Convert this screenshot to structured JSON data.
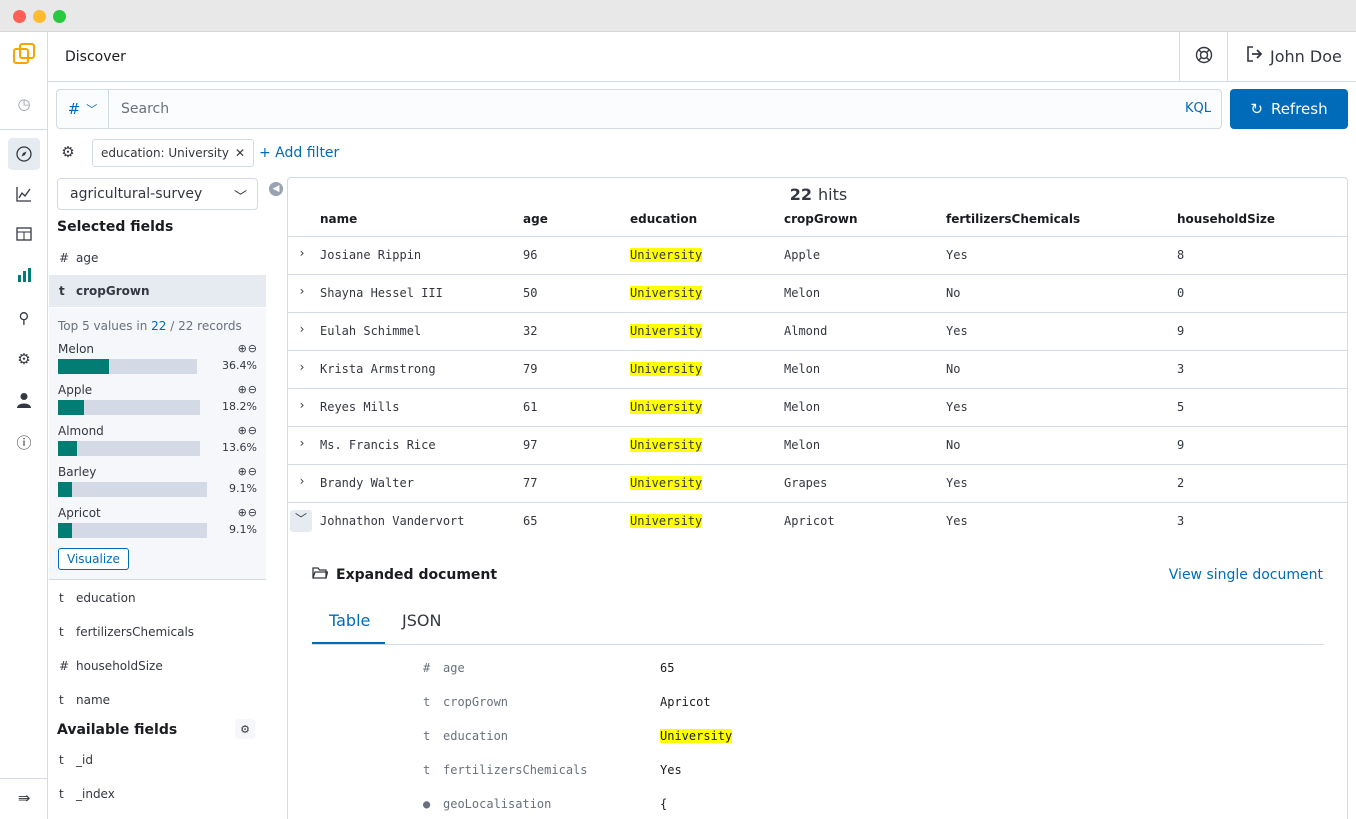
{
  "header": {
    "title": "Discover",
    "user_name": "John Doe"
  },
  "query": {
    "type_symbol": "#",
    "placeholder": "Search",
    "language": "KQL",
    "refresh_label": "Refresh"
  },
  "filters": {
    "pill_label": "education: University",
    "add_filter_label": "+ Add filter"
  },
  "sidebar": {
    "index_pattern": "agricultural-survey",
    "selected_heading": "Selected fields",
    "selected_fields": [
      {
        "type": "#",
        "name": "age"
      },
      {
        "type": "t",
        "name": "cropGrown"
      },
      {
        "type": "t",
        "name": "education"
      },
      {
        "type": "t",
        "name": "fertilizersChemicals"
      },
      {
        "type": "#",
        "name": "householdSize"
      },
      {
        "type": "t",
        "name": "name"
      }
    ],
    "details": {
      "caption_prefix": "Top 5 values in ",
      "caption_count": "22",
      "caption_suffix": " / 22 records",
      "buckets": [
        {
          "name": "Melon",
          "pct": "36.4%",
          "fraction": 0.364
        },
        {
          "name": "Apple",
          "pct": "18.2%",
          "fraction": 0.182
        },
        {
          "name": "Almond",
          "pct": "13.6%",
          "fraction": 0.136
        },
        {
          "name": "Barley",
          "pct": "9.1%",
          "fraction": 0.091
        },
        {
          "name": "Apricot",
          "pct": "9.1%",
          "fraction": 0.091
        }
      ],
      "zoom_icons": "🔍︎🔍︎",
      "visualize_label": "Visualize"
    },
    "available_heading": "Available fields",
    "available_fields": [
      {
        "type": "t",
        "name": "_id"
      },
      {
        "type": "t",
        "name": "_index"
      }
    ]
  },
  "results": {
    "hits_count": "22",
    "hits_label": "hits",
    "columns": [
      "name",
      "age",
      "education",
      "cropGrown",
      "fertilizersChemicals",
      "householdSize"
    ],
    "rows": [
      {
        "name": "Josiane Rippin",
        "age": "96",
        "education": "University",
        "cropGrown": "Apple",
        "fertilizersChemicals": "Yes",
        "householdSize": "8"
      },
      {
        "name": "Shayna Hessel III",
        "age": "50",
        "education": "University",
        "cropGrown": "Melon",
        "fertilizersChemicals": "No",
        "householdSize": "0"
      },
      {
        "name": "Eulah Schimmel",
        "age": "32",
        "education": "University",
        "cropGrown": "Almond",
        "fertilizersChemicals": "Yes",
        "householdSize": "9"
      },
      {
        "name": "Krista Armstrong",
        "age": "79",
        "education": "University",
        "cropGrown": "Melon",
        "fertilizersChemicals": "No",
        "householdSize": "3"
      },
      {
        "name": "Reyes Mills",
        "age": "61",
        "education": "University",
        "cropGrown": "Melon",
        "fertilizersChemicals": "Yes",
        "householdSize": "5"
      },
      {
        "name": "Ms. Francis Rice",
        "age": "97",
        "education": "University",
        "cropGrown": "Melon",
        "fertilizersChemicals": "No",
        "householdSize": "9"
      },
      {
        "name": "Brandy Walter",
        "age": "77",
        "education": "University",
        "cropGrown": "Grapes",
        "fertilizersChemicals": "Yes",
        "householdSize": "2"
      },
      {
        "name": "Johnathon Vandervort",
        "age": "65",
        "education": "University",
        "cropGrown": "Apricot",
        "fertilizersChemicals": "Yes",
        "householdSize": "3"
      }
    ],
    "expanded": {
      "title": "Expanded document",
      "view_single_label": "View single document",
      "tabs": [
        "Table",
        "JSON"
      ],
      "fields": [
        {
          "type": "#",
          "key": "age",
          "value": "65"
        },
        {
          "type": "t",
          "key": "cropGrown",
          "value": "Apricot"
        },
        {
          "type": "t",
          "key": "education",
          "value": "University"
        },
        {
          "type": "t",
          "key": "fertilizersChemicals",
          "value": "Yes"
        },
        {
          "type": "geo",
          "key": "geoLocalisation",
          "value": "{"
        }
      ]
    }
  },
  "colors": {
    "primary": "#006bb8",
    "highlight": "#ffff00",
    "bar_fill": "#017d73",
    "brand": "#f5a700"
  }
}
